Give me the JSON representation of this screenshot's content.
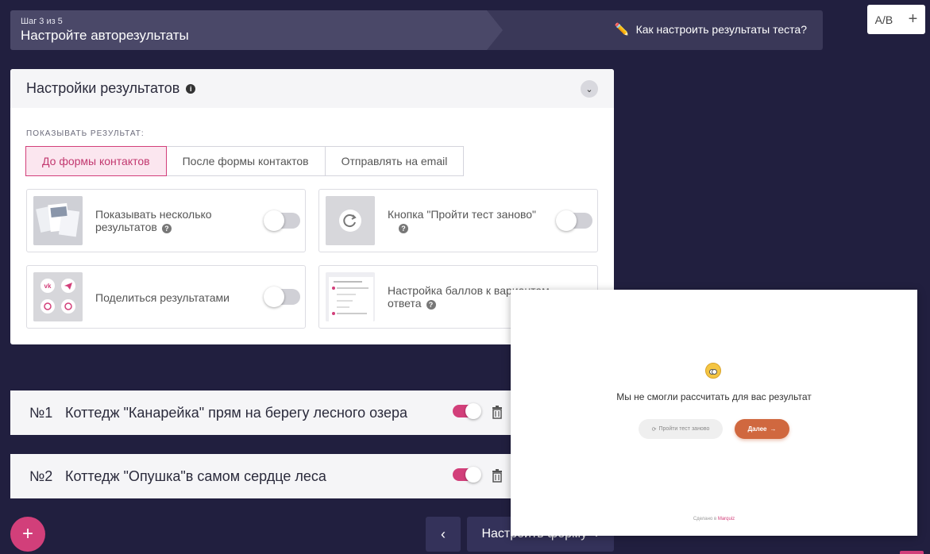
{
  "step": {
    "counter": "Шаг 3 из 5",
    "title": "Настройте авторезультаты",
    "help_link": "Как настроить результаты теста?"
  },
  "ab_widget": {
    "ab_label": "A/B",
    "add": "+"
  },
  "settings": {
    "title": "Настройки результатов",
    "show_label": "ПОКАЗЫВАТЬ РЕЗУЛЬТАТ:",
    "modes": [
      "До формы контактов",
      "После формы контактов",
      "Отправлять на email"
    ],
    "active_mode": 0,
    "cards": [
      {
        "label": "Показывать несколько результатов",
        "enabled": false,
        "has_help": true
      },
      {
        "label": "Кнопка \"Пройти тест заново\"",
        "enabled": false,
        "has_help": true
      },
      {
        "label": "Поделиться результатами",
        "enabled": false,
        "has_help": false
      },
      {
        "label": "Настройка баллов к вариантам ответа",
        "enabled": false,
        "has_help": true
      }
    ]
  },
  "results": [
    {
      "num": "№1",
      "title": "Коттедж \"Канарейка\" прям на берегу лесного озера",
      "enabled": true
    },
    {
      "num": "№2",
      "title": "Коттедж \"Опушка\"в самом сердце леса",
      "enabled": true
    }
  ],
  "footer": {
    "add": "+",
    "prev": "‹",
    "next_label": "Настроить форму",
    "next_arrow": "›"
  },
  "preview": {
    "message": "Мы не смогли рассчитать для вас результат",
    "retry": "Пройти тест заново",
    "next": "Далее",
    "next_arrow": "→",
    "made_with": "Сделано в",
    "brand": "Marquiz"
  },
  "colors": {
    "accent": "#d23f7a",
    "background": "#211f3f",
    "preview_button": "#d0683f"
  }
}
